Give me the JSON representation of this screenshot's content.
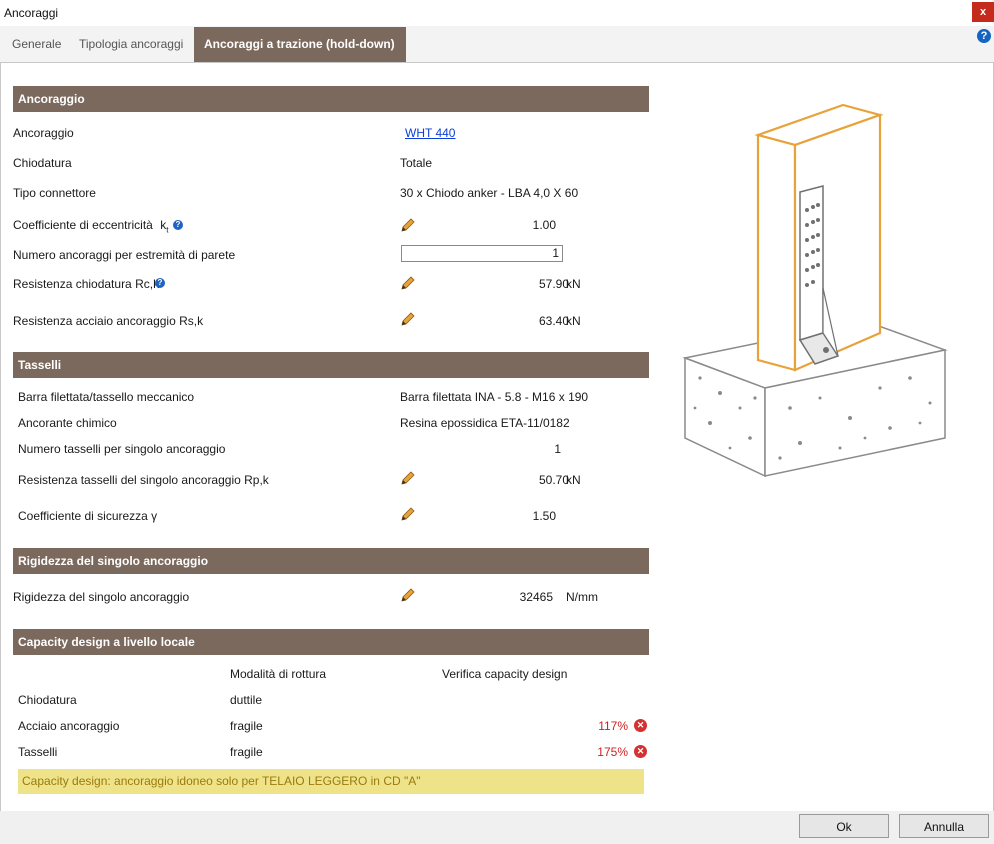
{
  "window": {
    "title": "Ancoraggi",
    "close_label": "x"
  },
  "tabs": [
    {
      "label": "Generale"
    },
    {
      "label": "Tipologia ancoraggi"
    },
    {
      "label": "Ancoraggi a trazione (hold-down)"
    }
  ],
  "help_label": "?",
  "ancoraggio": {
    "header": "Ancoraggio",
    "ancoraggio_label": "Ancoraggio",
    "ancoraggio_value": "WHT 440",
    "chiodatura_label": "Chiodatura",
    "chiodatura_value": "Totale",
    "connettore_label": "Tipo connettore",
    "connettore_value": "30 x Chiodo anker - LBA 4,0 X 60",
    "eccentricita_label": "Coefficiente di eccentricità",
    "eccentricita_symbol": "k",
    "eccentricita_sub": "t",
    "eccentricita_value": "1.00",
    "numero_label": "Numero ancoraggi per estremità di parete",
    "numero_value": "1",
    "rck_label": "Resistenza chiodatura Rc,k",
    "rck_value": "57.90",
    "rck_unit": "kN",
    "rsk_label": "Resistenza acciaio ancoraggio Rs,k",
    "rsk_value": "63.40",
    "rsk_unit": "kN"
  },
  "tasselli": {
    "header": "Tasselli",
    "barra_label": "Barra filettata/tassello meccanico",
    "barra_value": "Barra filettata INA - 5.8 - M16 x 190",
    "chimico_label": "Ancorante chimico",
    "chimico_value": "Resina epossidica ETA-11/0182",
    "numero_label": "Numero tasselli per singolo ancoraggio",
    "numero_value": "1",
    "rpk_label": "Resistenza tasselli del singolo ancoraggio Rp,k",
    "rpk_value": "50.70",
    "rpk_unit": "kN",
    "sicurezza_label": "Coefficiente di sicurezza γ",
    "sicurezza_value": "1.50"
  },
  "rigidezza": {
    "header": "Rigidezza del singolo ancoraggio",
    "label": "Rigidezza del singolo ancoraggio",
    "value": "32465",
    "unit": "N/mm"
  },
  "capacity": {
    "header": "Capacity design a livello locale",
    "col_modalita": "Modalità di rottura",
    "col_verifica": "Verifica capacity design",
    "rows": [
      {
        "label": "Chiodatura",
        "modalita": "duttile",
        "verifica": ""
      },
      {
        "label": "Acciaio ancoraggio",
        "modalita": "fragile",
        "verifica": "117%"
      },
      {
        "label": "Tasselli",
        "modalita": "fragile",
        "verifica": "175%"
      }
    ],
    "warning": "Capacity design: ancoraggio idoneo solo per TELAIO LEGGERO in CD \"A\""
  },
  "buttons": {
    "ok": "Ok",
    "cancel": "Annulla"
  },
  "colors": {
    "section_header": "#7b695d",
    "accent_orange": "#e8a23a",
    "error_red": "#d63030",
    "warning_bg": "#efe38a"
  }
}
